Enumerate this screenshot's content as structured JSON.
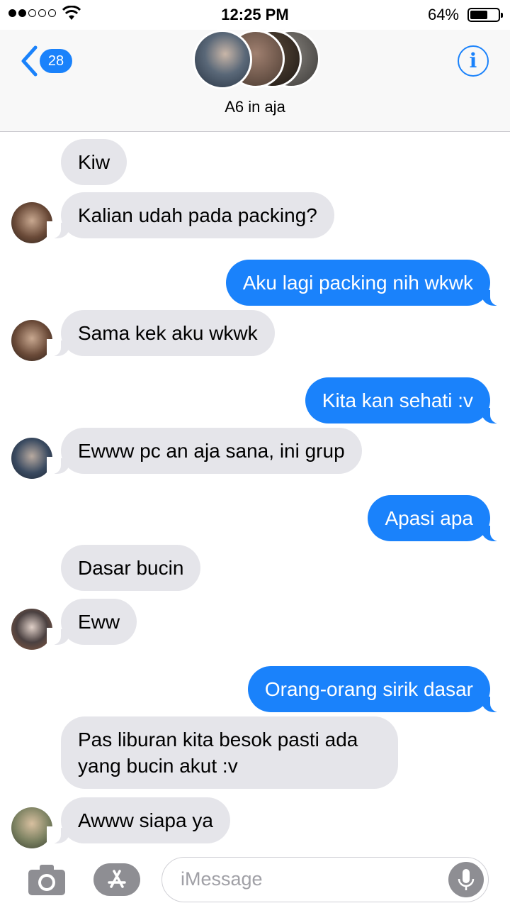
{
  "status_bar": {
    "time": "12:25 PM",
    "battery_pct": "64%",
    "battery_level": 0.64,
    "signal_bars": 2
  },
  "header": {
    "back_count": "28",
    "group_name": "A6 in aja",
    "info_icon": "i"
  },
  "messages": [
    {
      "side": "in",
      "text": "Kiw"
    },
    {
      "side": "in",
      "text": "Kalian udah pada packing?"
    },
    {
      "side": "out",
      "text": "Aku lagi packing nih wkwk"
    },
    {
      "side": "in",
      "text": "Sama kek aku wkwk"
    },
    {
      "side": "out",
      "text": "Kita kan sehati :v"
    },
    {
      "side": "in",
      "text": "Ewww pc an aja sana, ini grup"
    },
    {
      "side": "out",
      "text": "Apasi apa"
    },
    {
      "side": "in",
      "text": "Dasar bucin"
    },
    {
      "side": "in",
      "text": "Eww"
    },
    {
      "side": "out",
      "text": "Orang-orang sirik dasar"
    },
    {
      "side": "in",
      "text": "Pas liburan kita besok pasti ada yang bucin akut :v"
    },
    {
      "side": "in",
      "text": "Awww siapa ya"
    }
  ],
  "input": {
    "placeholder": "iMessage"
  },
  "colors": {
    "accent": "#1a82fb",
    "incoming_bubble": "#e5e5ea",
    "outgoing_bubble": "#1a82fb"
  }
}
